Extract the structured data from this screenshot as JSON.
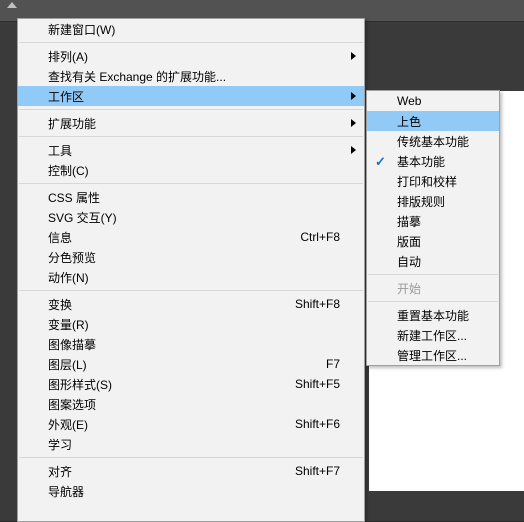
{
  "main_menu": [
    {
      "t": "item",
      "label": "新建窗口(W)"
    },
    {
      "t": "sep"
    },
    {
      "t": "item",
      "label": "排列(A)",
      "sub": true
    },
    {
      "t": "item",
      "label": "查找有关 Exchange 的扩展功能..."
    },
    {
      "t": "item",
      "label": "工作区",
      "sub": true,
      "hl": true
    },
    {
      "t": "sep"
    },
    {
      "t": "item",
      "label": "扩展功能",
      "sub": true
    },
    {
      "t": "sep"
    },
    {
      "t": "item",
      "label": "工具",
      "sub": true
    },
    {
      "t": "item",
      "label": "控制(C)"
    },
    {
      "t": "sep"
    },
    {
      "t": "item",
      "label": "CSS 属性"
    },
    {
      "t": "item",
      "label": "SVG 交互(Y)"
    },
    {
      "t": "item",
      "label": "信息",
      "shortcut": "Ctrl+F8"
    },
    {
      "t": "item",
      "label": "分色预览"
    },
    {
      "t": "item",
      "label": "动作(N)"
    },
    {
      "t": "sep"
    },
    {
      "t": "item",
      "label": "变换",
      "shortcut": "Shift+F8"
    },
    {
      "t": "item",
      "label": "变量(R)"
    },
    {
      "t": "item",
      "label": "图像描摹"
    },
    {
      "t": "item",
      "label": "图层(L)",
      "shortcut": "F7"
    },
    {
      "t": "item",
      "label": "图形样式(S)",
      "shortcut": "Shift+F5"
    },
    {
      "t": "item",
      "label": "图案选项"
    },
    {
      "t": "item",
      "label": "外观(E)",
      "shortcut": "Shift+F6"
    },
    {
      "t": "item",
      "label": "学习"
    },
    {
      "t": "sep"
    },
    {
      "t": "item",
      "label": "对齐",
      "shortcut": "Shift+F7"
    },
    {
      "t": "item",
      "label": "导航器"
    }
  ],
  "sub_menu": [
    {
      "t": "item",
      "label": "Web"
    },
    {
      "t": "item",
      "label": "上色",
      "hl": true
    },
    {
      "t": "item",
      "label": "传统基本功能"
    },
    {
      "t": "item",
      "label": "基本功能",
      "check": true
    },
    {
      "t": "item",
      "label": "打印和校样"
    },
    {
      "t": "item",
      "label": "排版规则"
    },
    {
      "t": "item",
      "label": "描摹"
    },
    {
      "t": "item",
      "label": "版面"
    },
    {
      "t": "item",
      "label": "自动"
    },
    {
      "t": "sep"
    },
    {
      "t": "item",
      "label": "开始",
      "disabled": true
    },
    {
      "t": "sep"
    },
    {
      "t": "item",
      "label": "重置基本功能"
    },
    {
      "t": "item",
      "label": "新建工作区..."
    },
    {
      "t": "item",
      "label": "管理工作区..."
    }
  ]
}
